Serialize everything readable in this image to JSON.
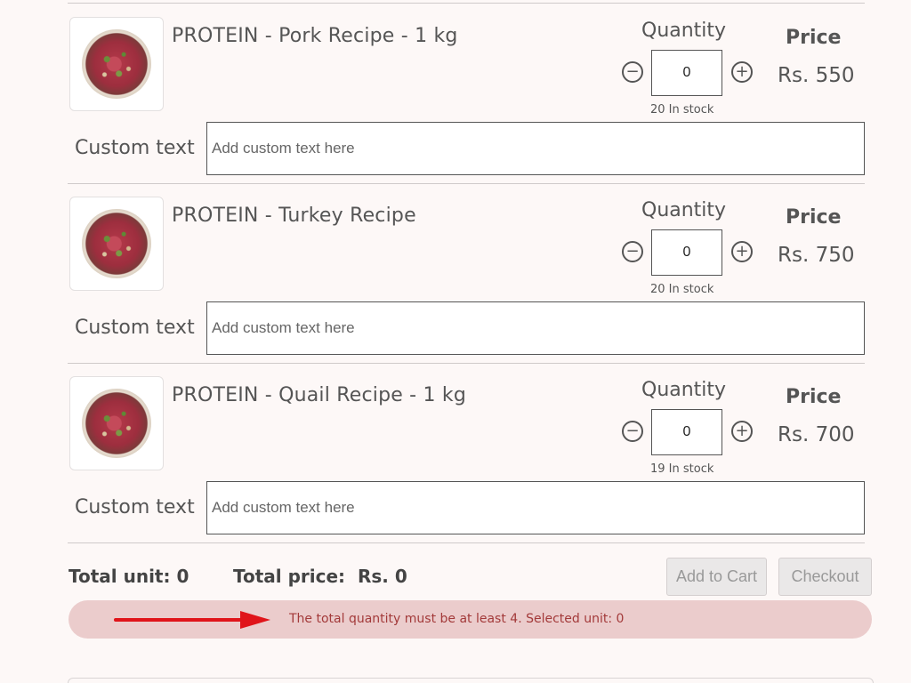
{
  "products": [
    {
      "name": "PROTEIN - Pork Recipe - 1 kg",
      "quantity_label": "Quantity",
      "quantity_value": "0",
      "stock": "20 In stock",
      "price_label": "Price",
      "price": "Rs. 550",
      "custom_label": "Custom text",
      "custom_placeholder": "Add custom text here"
    },
    {
      "name": "PROTEIN - Turkey Recipe",
      "quantity_label": "Quantity",
      "quantity_value": "0",
      "stock": "20 In stock",
      "price_label": "Price",
      "price": "Rs. 750",
      "custom_label": "Custom text",
      "custom_placeholder": "Add custom text here"
    },
    {
      "name": "PROTEIN - Quail Recipe - 1 kg",
      "quantity_label": "Quantity",
      "quantity_value": "0",
      "stock": "19 In stock",
      "price_label": "Price",
      "price": "Rs. 700",
      "custom_label": "Custom text",
      "custom_placeholder": "Add custom text here"
    }
  ],
  "summary": {
    "total_unit": "Total unit: 0",
    "total_price": "Total price:  Rs. 0",
    "add_to_cart": "Add to Cart",
    "checkout": "Checkout"
  },
  "alert": {
    "message": "The total quantity must be at least 4. Selected unit: 0",
    "arrow_color": "#e0141a"
  },
  "icons": {
    "minus": "minus-circle-icon",
    "plus": "plus-circle-icon"
  }
}
